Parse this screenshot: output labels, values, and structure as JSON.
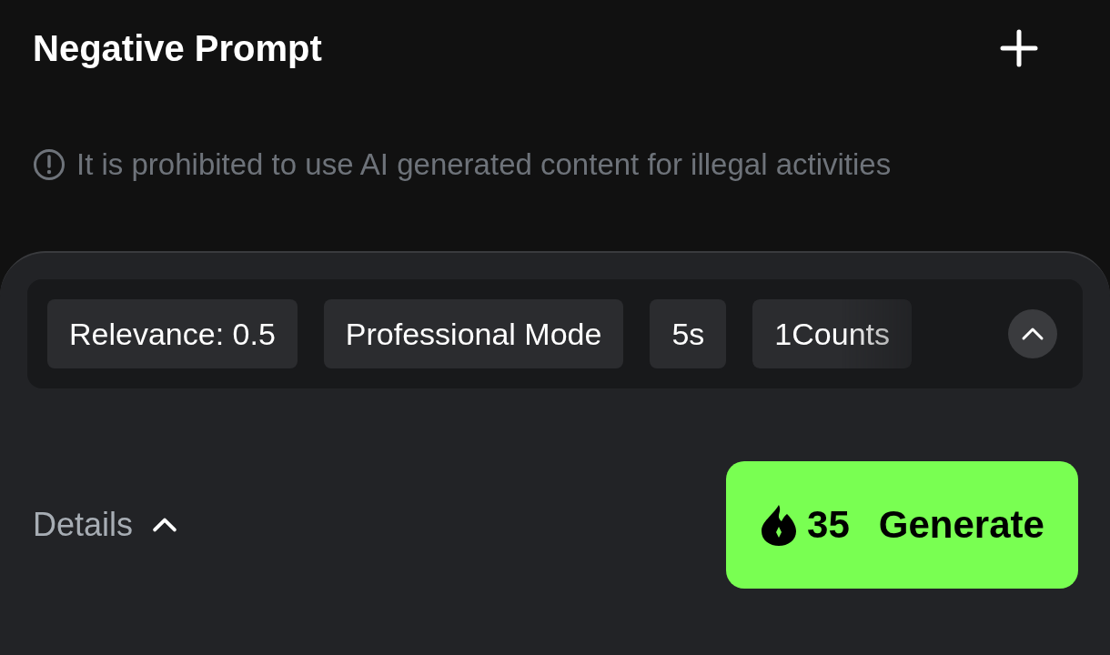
{
  "header": {
    "title": "Negative Prompt",
    "add_button": true
  },
  "notice": {
    "text": "It is prohibited to use AI generated content for illegal activities"
  },
  "settings": {
    "chips": [
      {
        "label": "Relevance: 0.5",
        "faded": false
      },
      {
        "label": "Professional Mode",
        "faded": false
      },
      {
        "label": "5s",
        "faded": false
      },
      {
        "label": "1Counts",
        "faded": true
      }
    ],
    "expanded": true
  },
  "footer": {
    "details_label": "Details",
    "details_expanded": true,
    "cost": "35",
    "generate_label": "Generate"
  }
}
